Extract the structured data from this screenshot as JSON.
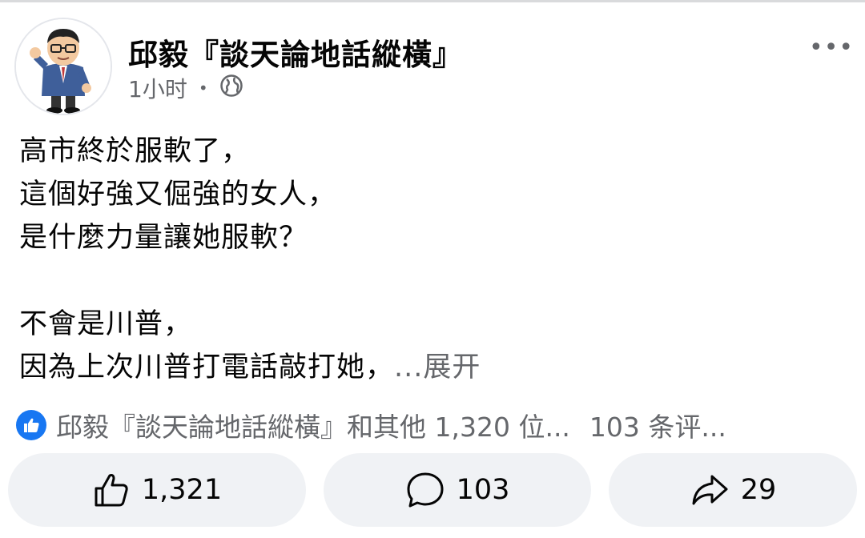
{
  "post": {
    "page_name": "邱毅『談天論地話縱橫』",
    "time": "1小时",
    "separator": "•",
    "audience_icon": "globe-icon",
    "more_icon": "more-horizontal-icon",
    "more_label": "•••",
    "text_lines": [
      "高市終於服軟了，",
      "這個好強又倔強的女人，",
      "是什麼力量讓她服軟？",
      "",
      "不會是川普，",
      "因為上次川普打電話敲打她，"
    ],
    "see_more": "...展开"
  },
  "reactions": {
    "icon": "like-icon",
    "summary": "邱毅『談天論地話縱橫』和其他 1,320 位...",
    "comments": "103 条评..."
  },
  "actions": {
    "like": {
      "icon": "thumbs-up-icon",
      "count": "1,321"
    },
    "comment": {
      "icon": "comment-icon",
      "count": "103"
    },
    "share": {
      "icon": "share-icon",
      "count": "29"
    }
  },
  "colors": {
    "accent": "#1877f2",
    "secondary_text": "#65676b",
    "button_bg": "#f0f2f5"
  }
}
